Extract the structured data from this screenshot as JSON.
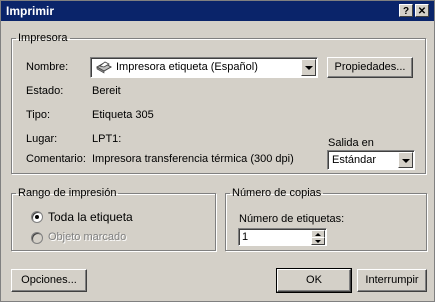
{
  "window": {
    "title": "Imprimir",
    "help_glyph": "?",
    "close_glyph": "✕"
  },
  "printer_group": {
    "legend": "Impresora",
    "name_label": "Nombre:",
    "name_value": "Impresora etiqueta (Español)",
    "properties_button": "Propiedades...",
    "status_label": "Estado:",
    "status_value": "Bereit",
    "type_label": "Tipo:",
    "type_value": "Etiqueta 305",
    "location_label": "Lugar:",
    "location_value": "LPT1:",
    "comment_label": "Comentario:",
    "comment_value": "Impresora transferencia térmica (300 dpi)",
    "output_label": "Salida en",
    "output_value": "Estándar"
  },
  "range_group": {
    "legend": "Rango de impresión",
    "option_all": "Toda la etiqueta",
    "option_selected": "Objeto marcado"
  },
  "copies_group": {
    "legend": "Número de copias",
    "label": "Número de etiquetas:",
    "value": "1"
  },
  "footer": {
    "options_button": "Opciones...",
    "ok_button": "OK",
    "cancel_button": "Interrumpir"
  }
}
